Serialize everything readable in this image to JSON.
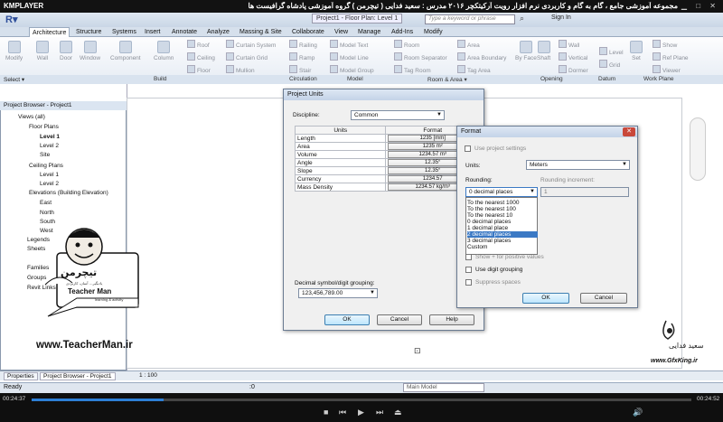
{
  "player": {
    "logo": "KMPLAYER",
    "title": "مجموعه آموزشی جامع ، گام به گام و کاربردی نرم افزار رویت آرکیتکچر ۲۰۱۶ مدرس : سعید فدایی ( تیچرمن ) گروه آموزشی پادشاه گرافیست ها",
    "time_current": "00:24:37",
    "time_total": "00:24:52",
    "progress": 0.2
  },
  "app": {
    "doc_tab": "Project1 - Floor Plan: Level 1",
    "search_placeholder": "Type a keyword or phrase",
    "signin": "Sign In",
    "tabs": [
      "Architecture",
      "Structure",
      "Systems",
      "Insert",
      "Annotate",
      "Analyze",
      "Massing & Site",
      "Collaborate",
      "View",
      "Manage",
      "Add-Ins",
      "Modify"
    ],
    "active_tab": "Architecture"
  },
  "ribbon": {
    "modify": "Modify",
    "wall": "Wall",
    "door": "Door",
    "window": "Window",
    "component": "Component",
    "column": "Column",
    "roof": "Roof",
    "ceiling": "Ceiling",
    "floor": "Floor",
    "curtain_system": "Curtain System",
    "curtain_grid": "Curtain Grid",
    "mullion": "Mullion",
    "railing": "Railing",
    "ramp": "Ramp",
    "stair": "Stair",
    "model_text": "Model Text",
    "model_line": "Model Line",
    "model_group": "Model Group",
    "room": "Room",
    "room_separator": "Room Separator",
    "tag_room": "Tag Room",
    "area": "Area",
    "area_boundary": "Area Boundary",
    "tag_area": "Tag Area",
    "by_face": "By Face",
    "shaft": "Shaft",
    "wall_op": "Wall",
    "vertical": "Vertical",
    "dormer": "Dormer",
    "level": "Level",
    "grid": "Grid",
    "set": "Set",
    "show": "Show",
    "ref_plane": "Ref Plane",
    "viewer": "Viewer",
    "panels": {
      "select": "Select ▾",
      "build": "Build",
      "circulation": "Circulation",
      "model": "Model",
      "room_area": "Room & Area ▾",
      "opening": "Opening",
      "datum": "Datum",
      "work_plane": "Work Plane"
    }
  },
  "browser": {
    "title": "Project Browser - Project1",
    "items": [
      "Views (all)",
      "Floor Plans",
      "Level 1",
      "Level 2",
      "Site",
      "Ceiling Plans",
      "Level 1",
      "Level 2",
      "Elevations (Building Elevation)",
      "East",
      "North",
      "South",
      "West",
      "Legends",
      "Sheets",
      "Families",
      "Groups",
      "Revit Links"
    ],
    "tab_properties": "Properties",
    "tab_browser": "Project Browser - Project1"
  },
  "view": {
    "scale": "1 : 100",
    "status": "Ready",
    "main_model": "Main Model",
    "status_zero": ":0"
  },
  "project_units": {
    "title": "Project Units",
    "discipline_label": "Discipline:",
    "discipline_value": "Common",
    "col_units": "Units",
    "col_format": "Format",
    "rows": [
      {
        "unit": "Length",
        "format": "1235 [mm]"
      },
      {
        "unit": "Area",
        "format": "1235 m²"
      },
      {
        "unit": "Volume",
        "format": "1234.57 m³"
      },
      {
        "unit": "Angle",
        "format": "12.35°"
      },
      {
        "unit": "Slope",
        "format": "12.35°"
      },
      {
        "unit": "Currency",
        "format": "1234.57"
      },
      {
        "unit": "Mass Density",
        "format": "1234.57 kg/m³"
      }
    ],
    "grouping_label": "Decimal symbol/digit grouping:",
    "grouping_value": "123,456,789.00",
    "ok": "OK",
    "cancel": "Cancel",
    "help": "Help"
  },
  "format": {
    "title": "Format",
    "use_project": "Use project settings",
    "units_label": "Units:",
    "units_value": "Meters",
    "rounding_label": "Rounding:",
    "rounding_increment_label": "Rounding increment:",
    "rounding_value": "0 decimal places",
    "increment_value": "1",
    "options": [
      "To the nearest 1000",
      "To the nearest 100",
      "To the nearest 10",
      "0 decimal places",
      "1 decimal place",
      "2 decimal places",
      "3 decimal places",
      "Custom"
    ],
    "selected_option_index": 5,
    "show_positive": "Show + for positive values",
    "use_digit_grouping": "Use digit grouping",
    "suppress_spaces": "Suppress spaces",
    "ok": "OK",
    "cancel": "Cancel"
  },
  "watermark": {
    "teacher_logo": "تیچرمن",
    "teacher_sub": "یادبگیر... آسان، کاربردی",
    "teacher_name": "Teacher Man",
    "teacher_tagline": "learning & activity",
    "teacher_url": "www.TeacherMan.ir",
    "gfx_name": "سعید فدایی",
    "gfx_url": "www.GfxKing.ir"
  },
  "colors": {
    "accent": "#3b79c4",
    "ribbon": "#d6e0ec",
    "player": "#121212"
  }
}
